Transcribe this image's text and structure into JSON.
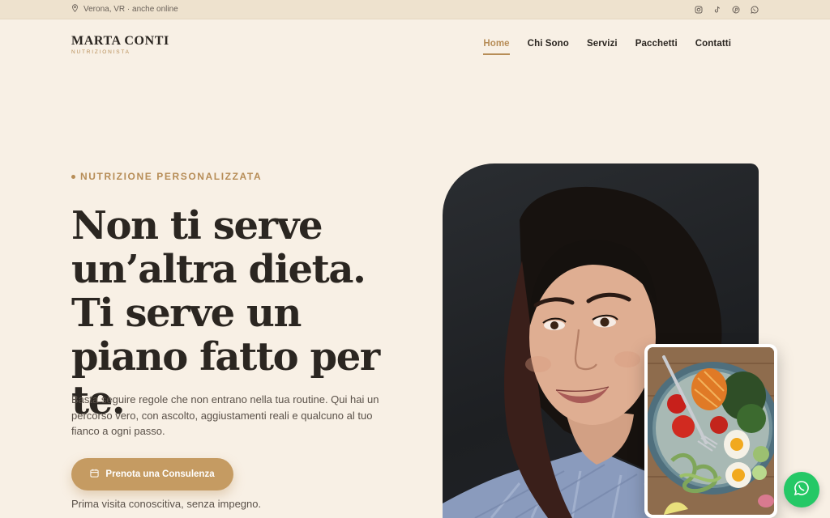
{
  "topbar": {
    "location": "Verona, VR · anche online",
    "socials": [
      "instagram-icon",
      "tiktok-icon",
      "pinterest-icon",
      "whatsapp-icon"
    ]
  },
  "brand": {
    "name": "MARTA CONTI",
    "subtitle": "NUTRIZIONISTA"
  },
  "nav": {
    "items": [
      "Home",
      "Chi Sono",
      "Servizi",
      "Pacchetti",
      "Contatti"
    ],
    "active": "Home"
  },
  "hero": {
    "eyebrow": "NUTRIZIONE PERSONALIZZATA",
    "headline": "Non ti serve un’altra dieta. Ti serve un piano fatto per te.",
    "intro": "Basta seguire regole che non entrano nella tua routine. Qui hai un percorso vero, con ascolto, aggiustamenti reali e qualcuno al tuo fianco a ogni passo.",
    "cta_label": "Prenota una Consulenza",
    "note": "Prima visita conoscitiva, senza impegno."
  },
  "colors": {
    "background": "#f8f0e5",
    "topbar": "#eee2ce",
    "accent": "#b78d57",
    "cta": "#c59b62",
    "whatsapp": "#25c866"
  }
}
